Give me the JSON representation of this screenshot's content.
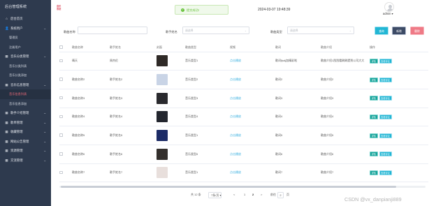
{
  "sidebar": {
    "brand": "后台管理系统",
    "items": [
      {
        "label": "后台首页",
        "icon": "home-icon",
        "expandable": false
      },
      {
        "label": "系统用户",
        "icon": "user-icon",
        "expandable": true
      },
      {
        "label": "管理员",
        "sub": true
      },
      {
        "label": "注册用户",
        "sub": true
      },
      {
        "label": "音乐分类管理",
        "icon": "grid-icon",
        "expandable": true
      },
      {
        "label": "音乐分类列表",
        "sub": true
      },
      {
        "label": "音乐分类添加",
        "sub": true
      },
      {
        "label": "音乐信息管理",
        "icon": "grid-icon",
        "expandable": true
      },
      {
        "label": "音乐信息列表",
        "sub": true,
        "active": true
      },
      {
        "label": "音乐信息添加",
        "sub": true
      },
      {
        "label": "歌手介绍管理",
        "icon": "grid-icon",
        "expandable": true
      },
      {
        "label": "歌单管理",
        "icon": "grid-icon",
        "expandable": true
      },
      {
        "label": "收藏管理",
        "icon": "grid-icon",
        "expandable": true
      },
      {
        "label": "网站公告管理",
        "icon": "grid-icon",
        "expandable": true
      },
      {
        "label": "资源管理",
        "icon": "grid-icon",
        "expandable": true
      },
      {
        "label": "交流管理",
        "icon": "grid-icon",
        "expandable": true
      }
    ]
  },
  "topbar": {
    "logo_text": "音乐 系统",
    "toast": "提交成功!",
    "datetime": "2024-03-07 19:48:39",
    "user_name": "admin ▾"
  },
  "search": {
    "song_name_label": "歌曲名称",
    "song_name_placeholder": "",
    "singer_label": "歌手姓名",
    "singer_placeholder": "请选择",
    "type_label": "歌曲类型",
    "type_placeholder": "请选择",
    "query_btn": "查询",
    "add_btn": "新增",
    "delete_btn": "删除"
  },
  "table": {
    "columns": [
      "歌曲名称",
      "歌手姓名",
      "封面",
      "歌曲类型",
      "视频",
      "歌词",
      "歌曲介绍",
      "操作"
    ],
    "rows": [
      {
        "name": "晴天",
        "singer": "周杰伦",
        "type": "音乐类型1",
        "video": "点击播放",
        "lyrics": "歌词fjsdj加精彩啦",
        "intro": "歌曲介绍1刮刮看刷刷提到公司大大",
        "cover": "#2f2a27"
      },
      {
        "name": "歌曲名称2",
        "singer": "歌手姓名2",
        "type": "音乐类型2",
        "video": "点击播放",
        "lyrics": "歌词2",
        "intro": "歌曲介绍2",
        "cover": "#c9d4e6"
      },
      {
        "name": "歌曲名称3",
        "singer": "歌手姓名3",
        "type": "音乐类型3",
        "video": "点击播放",
        "lyrics": "歌词3",
        "intro": "歌曲介绍3",
        "cover": "#2a2a2e"
      },
      {
        "name": "歌曲名称4",
        "singer": "歌手姓名4",
        "type": "音乐类型4",
        "video": "点击播放",
        "lyrics": "歌词4",
        "intro": "歌曲介绍4",
        "cover": "#23262e"
      },
      {
        "name": "歌曲名称5",
        "singer": "歌手姓名5",
        "type": "音乐类型1",
        "video": "点击播放",
        "lyrics": "歌词5",
        "intro": "歌曲介绍5",
        "cover": "#1c2b66"
      },
      {
        "name": "歌曲名称6",
        "singer": "歌手姓名6",
        "type": "音乐类型6",
        "video": "点击播放",
        "lyrics": "歌词6",
        "intro": "歌曲介绍6",
        "cover": "#34302d"
      },
      {
        "name": "歌曲名称7",
        "singer": "歌手姓名7",
        "type": "音乐类型1",
        "video": "点击播放",
        "lyrics": "歌词7",
        "intro": "歌曲介绍7",
        "cover": "#e8dfdc"
      }
    ],
    "detail_btn": "详情",
    "comment_btn": "查看评论"
  },
  "pager": {
    "total": "共 12 条",
    "page_size": "7条/页 ▾",
    "prev": "<",
    "pages": [
      "1",
      "2"
    ],
    "current": "2",
    "next": ">",
    "goto_label": "前往",
    "goto_value": "2",
    "goto_suffix": "页"
  },
  "watermark": "CSDN @vx_danpianji889"
}
